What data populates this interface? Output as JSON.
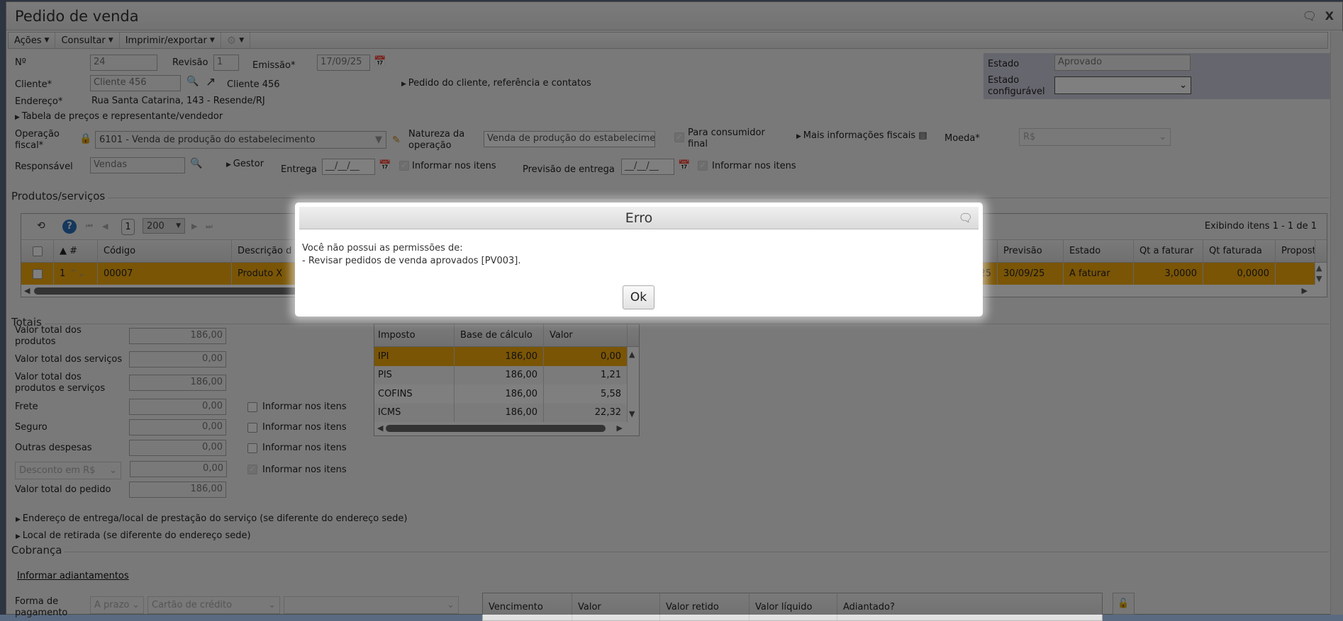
{
  "window": {
    "title": "Pedido de venda",
    "comment_icon": "speech-bubble-icon",
    "close_label": "X"
  },
  "toolbar": {
    "acoes": "Ações",
    "consultar": "Consultar",
    "imprimir": "Imprimir/exportar",
    "arrow": "▼"
  },
  "header": {
    "numero_label": "Nº",
    "numero": "24",
    "revisao_label": "Revisão",
    "revisao": "1",
    "emissao_label": "Emissão*",
    "emissao": "17/09/25",
    "cliente_label": "Cliente*",
    "cliente": "Cliente 456",
    "cliente_link": "Cliente 456",
    "pedido_cliente": "Pedido do cliente, referência e contatos",
    "endereco_label": "Endereço*",
    "endereco": "Rua Santa Catarina, 143 - Resende/RJ",
    "tabela_precos": "Tabela de preços e representante/vendedor",
    "operacao_label1": "Operação",
    "operacao_label2": "fiscal*",
    "operacao": "6101 - Venda de produção do estabelecimento",
    "natureza_label1": "Natureza da",
    "natureza_label2": "operação",
    "natureza": "Venda de produção do estabelecimento",
    "consumidor1": "Para consumidor",
    "consumidor2": "final",
    "mais_info": "Mais informações fiscais",
    "moeda_label": "Moeda*",
    "moeda": "R$",
    "responsavel_label": "Responsável",
    "responsavel": "Vendas",
    "gestor": "Gestor",
    "entrega_label": "Entrega",
    "entrega": "__/__/__",
    "informar": "Informar nos itens",
    "previsao_label": "Previsão de entrega",
    "previsao": "__/__/__",
    "estado_label": "Estado",
    "estado": "Aprovado",
    "estado_conf1": "Estado",
    "estado_conf2": "configurável",
    "estado_conf": ""
  },
  "produtos": {
    "section": "Produtos/serviços",
    "page": "1",
    "page_size": "200",
    "info": "Exibindo itens 1 - 1 de 1",
    "columns": {
      "num": "▲ #",
      "codigo": "Código",
      "descricao": "Descrição d",
      "previsao": "Previsão",
      "estado": "Estado",
      "qt_faturar": "Qt a faturar",
      "qt_faturada": "Qt faturada",
      "proposta": "Propost"
    },
    "row": {
      "num": "1",
      "codigo": "00007",
      "descricao": "Produto X",
      "hidden_tail": "25",
      "previsao": "30/09/25",
      "estado": "A faturar",
      "qt_faturar": "3,0000",
      "qt_faturada": "0,0000"
    }
  },
  "totais": {
    "section": "Totais",
    "rows": [
      {
        "label1": "Valor total dos",
        "label2": "produtos",
        "value": "186,00"
      },
      {
        "label1": "Valor total dos serviços",
        "label2": "",
        "value": "0,00"
      },
      {
        "label1": "Valor total dos",
        "label2": "produtos e serviços",
        "value": "186,00"
      },
      {
        "label1": "Frete",
        "label2": "",
        "value": "0,00"
      },
      {
        "label1": "Seguro",
        "label2": "",
        "value": "0,00"
      },
      {
        "label1": "Outras despesas",
        "label2": "",
        "value": "0,00"
      },
      {
        "label1": "",
        "label2": "",
        "value": "0,00"
      },
      {
        "label1": "Valor total do pedido",
        "label2": "",
        "value": "186,00"
      }
    ],
    "desconto": "Desconto em R$",
    "informar": "Informar nos itens",
    "impostos": {
      "columns": [
        "Imposto",
        "Base de cálculo",
        "Valor"
      ],
      "rows": [
        [
          "IPI",
          "186,00",
          "0,00"
        ],
        [
          "PIS",
          "186,00",
          "1,21"
        ],
        [
          "COFINS",
          "186,00",
          "5,58"
        ],
        [
          "ICMS",
          "186,00",
          "22,32"
        ]
      ]
    }
  },
  "links": {
    "endereco_entrega": "Endereço de entrega/local de prestação do serviço (se diferente do endereço sede)",
    "local_retirada": "Local de retirada (se diferente do endereço sede)"
  },
  "cobranca": {
    "section": "Cobrança",
    "adiantamentos": "Informar adiantamentos",
    "forma1": "Forma de",
    "forma2": "pagamento",
    "prazo": "A prazo",
    "cartao": "Cartão de crédito",
    "extra": "",
    "columns": [
      "Vencimento",
      "Valor",
      "Valor retido",
      "Valor líquido",
      "Adiantado?"
    ]
  },
  "dialog": {
    "title": "Erro",
    "line1": "Você não possui as permissões de:",
    "line2": "- Revisar pedidos de venda aprovados [PV003].",
    "ok": "Ok"
  },
  "colors": {
    "highlight": "#f4aa0c",
    "estado_panel": "#ccccdd"
  }
}
